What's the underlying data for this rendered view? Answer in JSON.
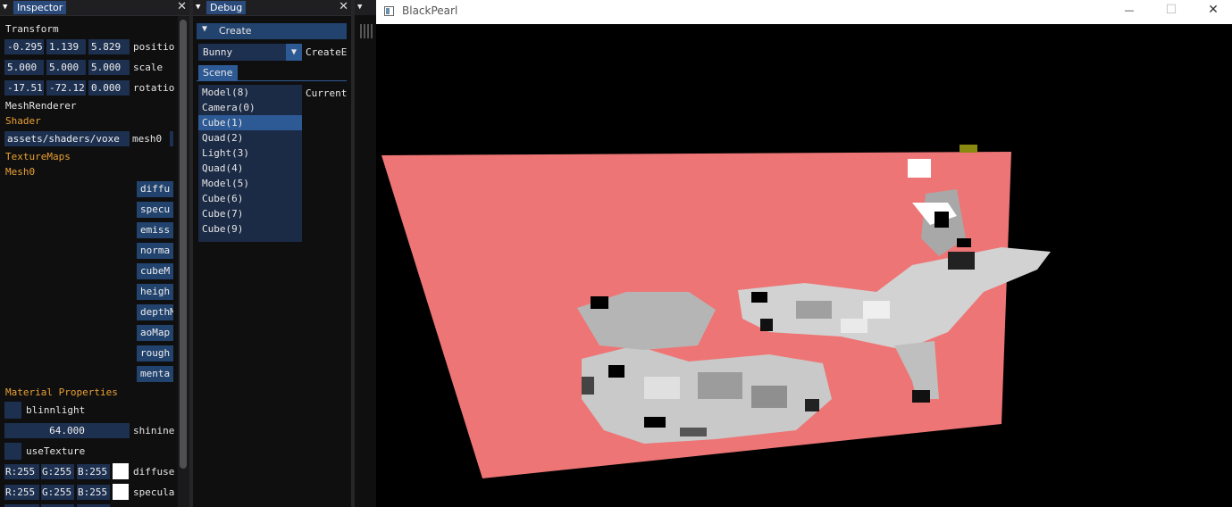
{
  "inspector": {
    "title": "Inspector",
    "close": "✕",
    "transform_label": "Transform",
    "position": {
      "x": "-0.295",
      "y": "1.139",
      "z": "5.829",
      "label": "positio"
    },
    "scale": {
      "x": "5.000",
      "y": "5.000",
      "z": "5.000",
      "label": "scale"
    },
    "rotation": {
      "x": "-17.51",
      "y": "-72.12",
      "z": "0.000",
      "label": "rotatio"
    },
    "mesh_renderer_label": "MeshRenderer",
    "shader_label": "Shader",
    "shader_path": "assets/shaders/voxe",
    "mesh_name": "mesh0",
    "texture_maps_label": "TextureMaps",
    "mesh0_label": "Mesh0",
    "texture_buttons": [
      "diffu",
      "specu",
      "emiss",
      "norma",
      "cubeM",
      "heigh",
      "depthM",
      "aoMap",
      "rough",
      "menta"
    ],
    "material_properties_label": "Material Properties",
    "blinnlight_label": "blinnlight",
    "shininess_value": "64.000",
    "shininess_label": "shinine",
    "use_texture_label": "useTexture",
    "diffuse": {
      "r": "R:255",
      "g": "G:255",
      "b": "B:255",
      "label": "diffuse"
    },
    "specular": {
      "r": "R:255",
      "g": "G:255",
      "b": "B:255",
      "label": "specula"
    }
  },
  "debug": {
    "title": "Debug",
    "close": "✕",
    "create_header": "Create",
    "create_arrow": "▼",
    "dropdown_value": "Bunny",
    "dropdown_arrow": "▼",
    "create_entity_label": "CreateE",
    "scene_tab": "Scene",
    "current_label": "Current",
    "scene_items": [
      "Model(8)",
      "Camera(0)",
      "Cube(1)",
      "Quad(2)",
      "Light(3)",
      "Quad(4)",
      "Model(5)",
      "Cube(6)",
      "Cube(7)",
      "Cube(9)"
    ],
    "selected_index": 2
  },
  "window": {
    "title": "BlackPearl",
    "minimize": "—",
    "maximize": "☐",
    "close": "✕"
  },
  "colors": {
    "floor": "#ee7575",
    "title_active": "#294a7a",
    "accent_orange": "#e8a030",
    "field_bg": "#1d3050"
  }
}
